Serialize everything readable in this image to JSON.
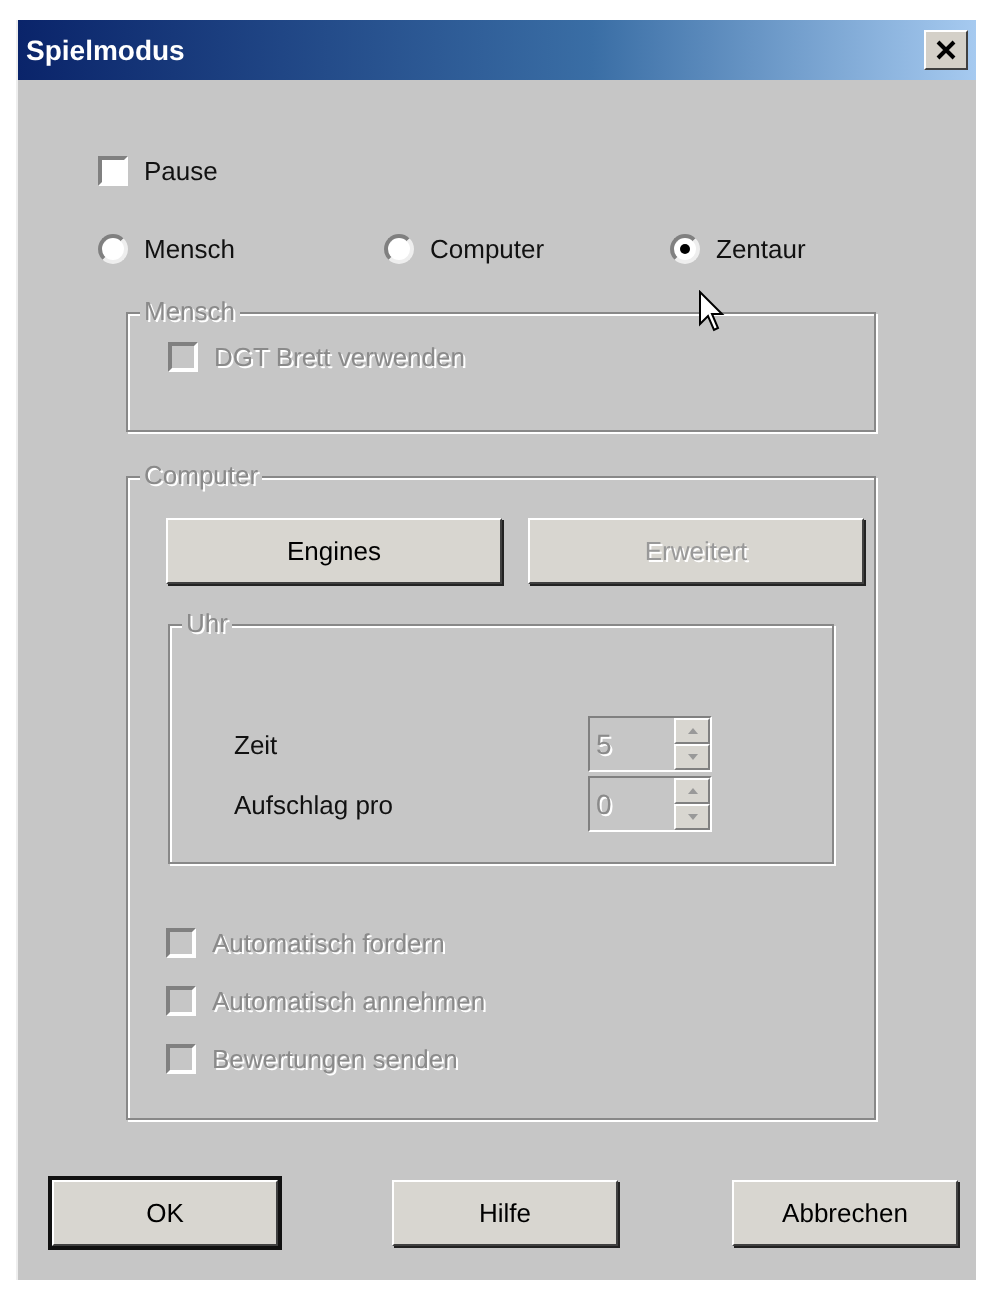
{
  "window": {
    "title": "Spielmodus"
  },
  "pause": {
    "label": "Pause",
    "checked": false
  },
  "modes": [
    {
      "label": "Mensch",
      "selected": false
    },
    {
      "label": "Computer",
      "selected": false
    },
    {
      "label": "Zentaur",
      "selected": true
    }
  ],
  "mensch_group": {
    "title": "Mensch",
    "disabled": true,
    "options": [
      {
        "label": "DGT Brett verwenden",
        "checked": false,
        "disabled": true
      }
    ]
  },
  "computer_group": {
    "title": "Computer",
    "disabled": true,
    "buttons": [
      {
        "label": "Engines",
        "disabled": false
      },
      {
        "label": "Erweitert",
        "disabled": true
      }
    ],
    "clock": {
      "title": "Uhr",
      "disabled": true,
      "fields": [
        {
          "label": "Zeit",
          "value": "5",
          "disabled": true
        },
        {
          "label": "Aufschlag pro",
          "value": "0",
          "disabled": true
        }
      ]
    },
    "options": [
      {
        "label": "Automatisch fordern",
        "checked": false,
        "disabled": true
      },
      {
        "label": "Automatisch annehmen",
        "checked": false,
        "disabled": true
      },
      {
        "label": "Bewertungen senden",
        "checked": false,
        "disabled": true
      }
    ]
  },
  "buttons": [
    {
      "label": "OK",
      "default": true
    },
    {
      "label": "Hilfe",
      "default": false
    },
    {
      "label": "Abbrechen",
      "default": false
    }
  ]
}
